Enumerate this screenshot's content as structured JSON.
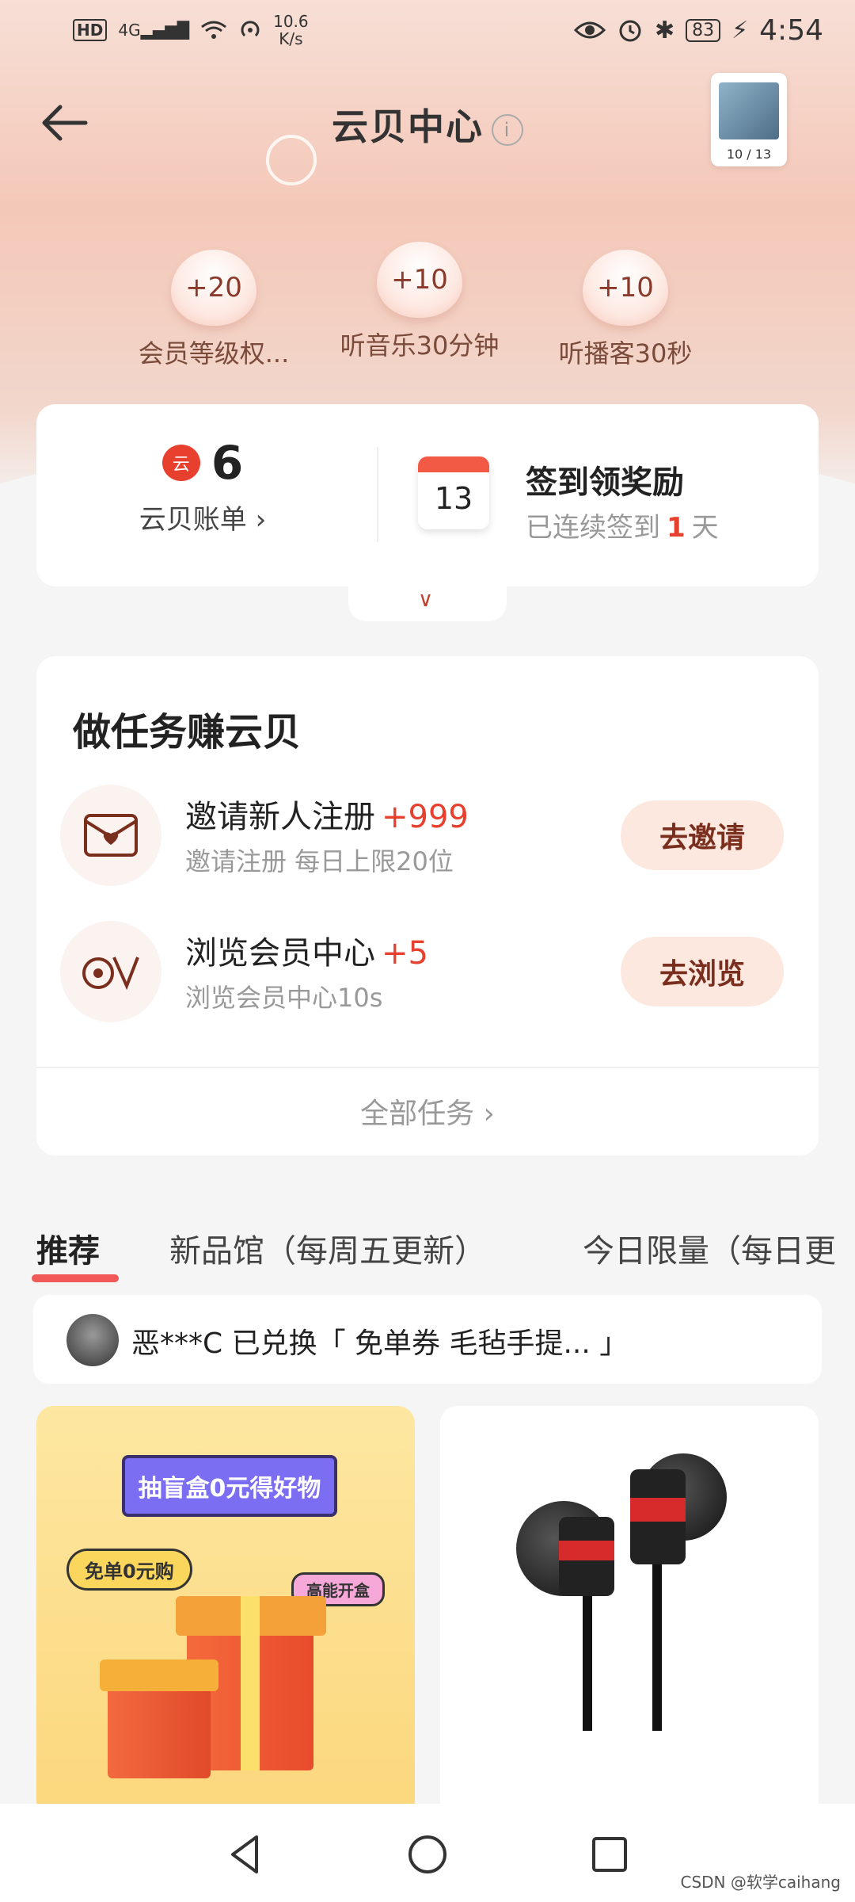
{
  "status_bar": {
    "network": "4G",
    "speed": "10.6",
    "speed_unit": "K/s",
    "battery": "83",
    "time": "4:54"
  },
  "header": {
    "title": "云贝中心",
    "info_glyph": "i",
    "album_count": "10 / 13"
  },
  "rewards": [
    {
      "value": "+20",
      "label": "会员等级权..."
    },
    {
      "value": "+10",
      "label": "听音乐30分钟"
    },
    {
      "value": "+10",
      "label": "听播客30秒"
    }
  ],
  "summary": {
    "coin_icon_text": "云",
    "coin_balance": "6",
    "coin_link": "云贝账单 ›",
    "calendar_day": "13",
    "checkin_title": "签到领奖励",
    "checkin_prefix": "已连续签到",
    "checkin_days": "1",
    "checkin_suffix": "天"
  },
  "tasks": {
    "title": "做任务赚云贝",
    "items": [
      {
        "name": "邀请新人注册",
        "bonus": "+999",
        "desc": "邀请注册 每日上限20位",
        "button": "去邀请",
        "icon": "envelope-heart-icon"
      },
      {
        "name": "浏览会员中心",
        "bonus": "+5",
        "desc": "浏览会员中心10s",
        "button": "去浏览",
        "icon": "vip-logo-icon"
      }
    ],
    "all_link": "全部任务 ›"
  },
  "tabs": [
    {
      "label": "推荐",
      "active": true
    },
    {
      "label": "新品馆（每周五更新）",
      "active": false
    },
    {
      "label": "今日限量（每日更",
      "active": false
    }
  ],
  "ticker": {
    "text": "恶***C 已兑换「 免单券 毛毡手提... 」"
  },
  "products": [
    {
      "banner_title": "抽盲盒0元得好物",
      "tag_primary": "免单0元购",
      "tag_secondary": "高能开盒"
    },
    {
      "image": "earphone"
    }
  ],
  "watermark": "CSDN @软学caihang",
  "colors": {
    "accent_red": "#e8402e",
    "button_bg": "#fce8df",
    "button_text": "#7a2e1e"
  }
}
